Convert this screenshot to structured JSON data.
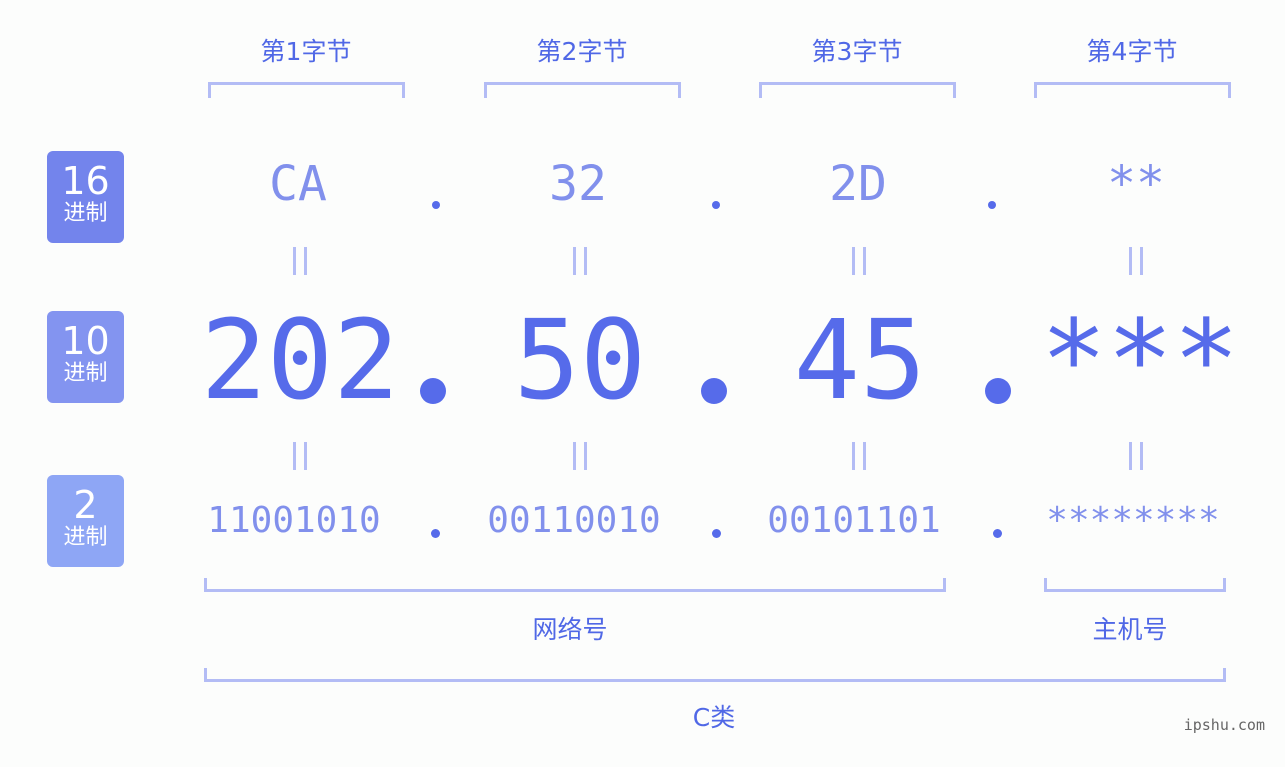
{
  "byte_headers": [
    "第1字节",
    "第2字节",
    "第3字节",
    "第4字节"
  ],
  "badges": [
    {
      "num": "16",
      "label": "进制",
      "color": "#7384ec"
    },
    {
      "num": "10",
      "label": "进制",
      "color": "#8394f0"
    },
    {
      "num": "2",
      "label": "进制",
      "color": "#8ea6f5"
    }
  ],
  "hex": [
    "CA",
    "32",
    "2D",
    "**"
  ],
  "decimal": [
    "202",
    "50",
    "45",
    "***"
  ],
  "binary": [
    "11001010",
    "00110010",
    "00101101",
    "********"
  ],
  "sections": {
    "network": "网络号",
    "host": "主机号",
    "class": "C类"
  },
  "watermark": "ipshu.com"
}
